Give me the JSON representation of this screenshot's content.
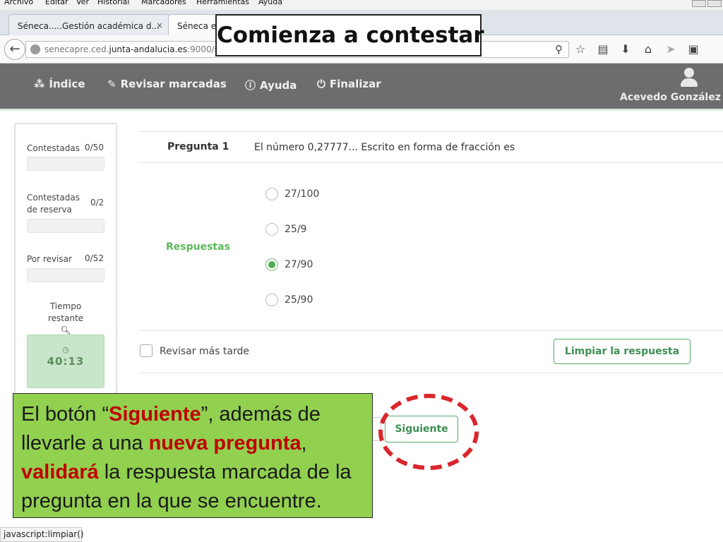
{
  "browser": {
    "menu": [
      "Archivo",
      "Editar",
      "Ver",
      "Historial",
      "Marcadores",
      "Herramientas",
      "Ayuda"
    ],
    "tabs": [
      {
        "label": "Séneca.....Gestión académica d...",
        "close": "×"
      },
      {
        "label": "Séneca ex"
      }
    ],
    "url_prefix": "senecapre.ced.",
    "url_domain": "junta-andalucia.es",
    "url_suffix": ":9000/sen",
    "status_text": "javascript:limpiar()"
  },
  "header": {
    "menu": [
      {
        "icon": "sitemap-icon",
        "label": "Índice"
      },
      {
        "icon": "pencil-icon",
        "label": "Revisar marcadas"
      },
      {
        "icon": "info-icon",
        "label": "Ayuda"
      },
      {
        "icon": "power-icon",
        "label": "Finalizar"
      }
    ],
    "user_name": "Acevedo González"
  },
  "sidebar": {
    "answered_label": "Contestadas",
    "answered_value": "0/50",
    "reserve_label_1": "Contestadas",
    "reserve_label_2": "de reserva",
    "reserve_value": "0/2",
    "review_label": "Por revisar",
    "review_value": "0/52",
    "time_label_1": "Tiempo",
    "time_label_2": "restante",
    "time_value": "40:13"
  },
  "question": {
    "label": "Pregunta 1",
    "text": "El número 0,27777... Escrito en forma de fracción es",
    "answers_label": "Respuestas",
    "options": [
      {
        "text": "27/100",
        "selected": false
      },
      {
        "text": "25/9",
        "selected": false
      },
      {
        "text": "27/90",
        "selected": true
      },
      {
        "text": "25/90",
        "selected": false
      }
    ],
    "review_later_label": "Revisar más tarde",
    "clear_button": "Limpiar la respuesta",
    "next_button": "Siguiente"
  },
  "annotations": {
    "title": "Comienza a contestar",
    "note_part1": "El botón “",
    "note_red1": "Siguiente",
    "note_part2": "”, además de llevarle a una ",
    "note_red2": "nueva pregunta",
    "note_part3": ", ",
    "note_red3": "validará",
    "note_part4": " la respuesta marcada de la pregunta en la que se encuentre.",
    "ring_color": "#d9262c",
    "note_bg": "#92d050"
  },
  "colors": {
    "accent_green": "#5cb85c",
    "header_gray": "#6d6d6d",
    "timer_bg": "#c8e6c9"
  }
}
